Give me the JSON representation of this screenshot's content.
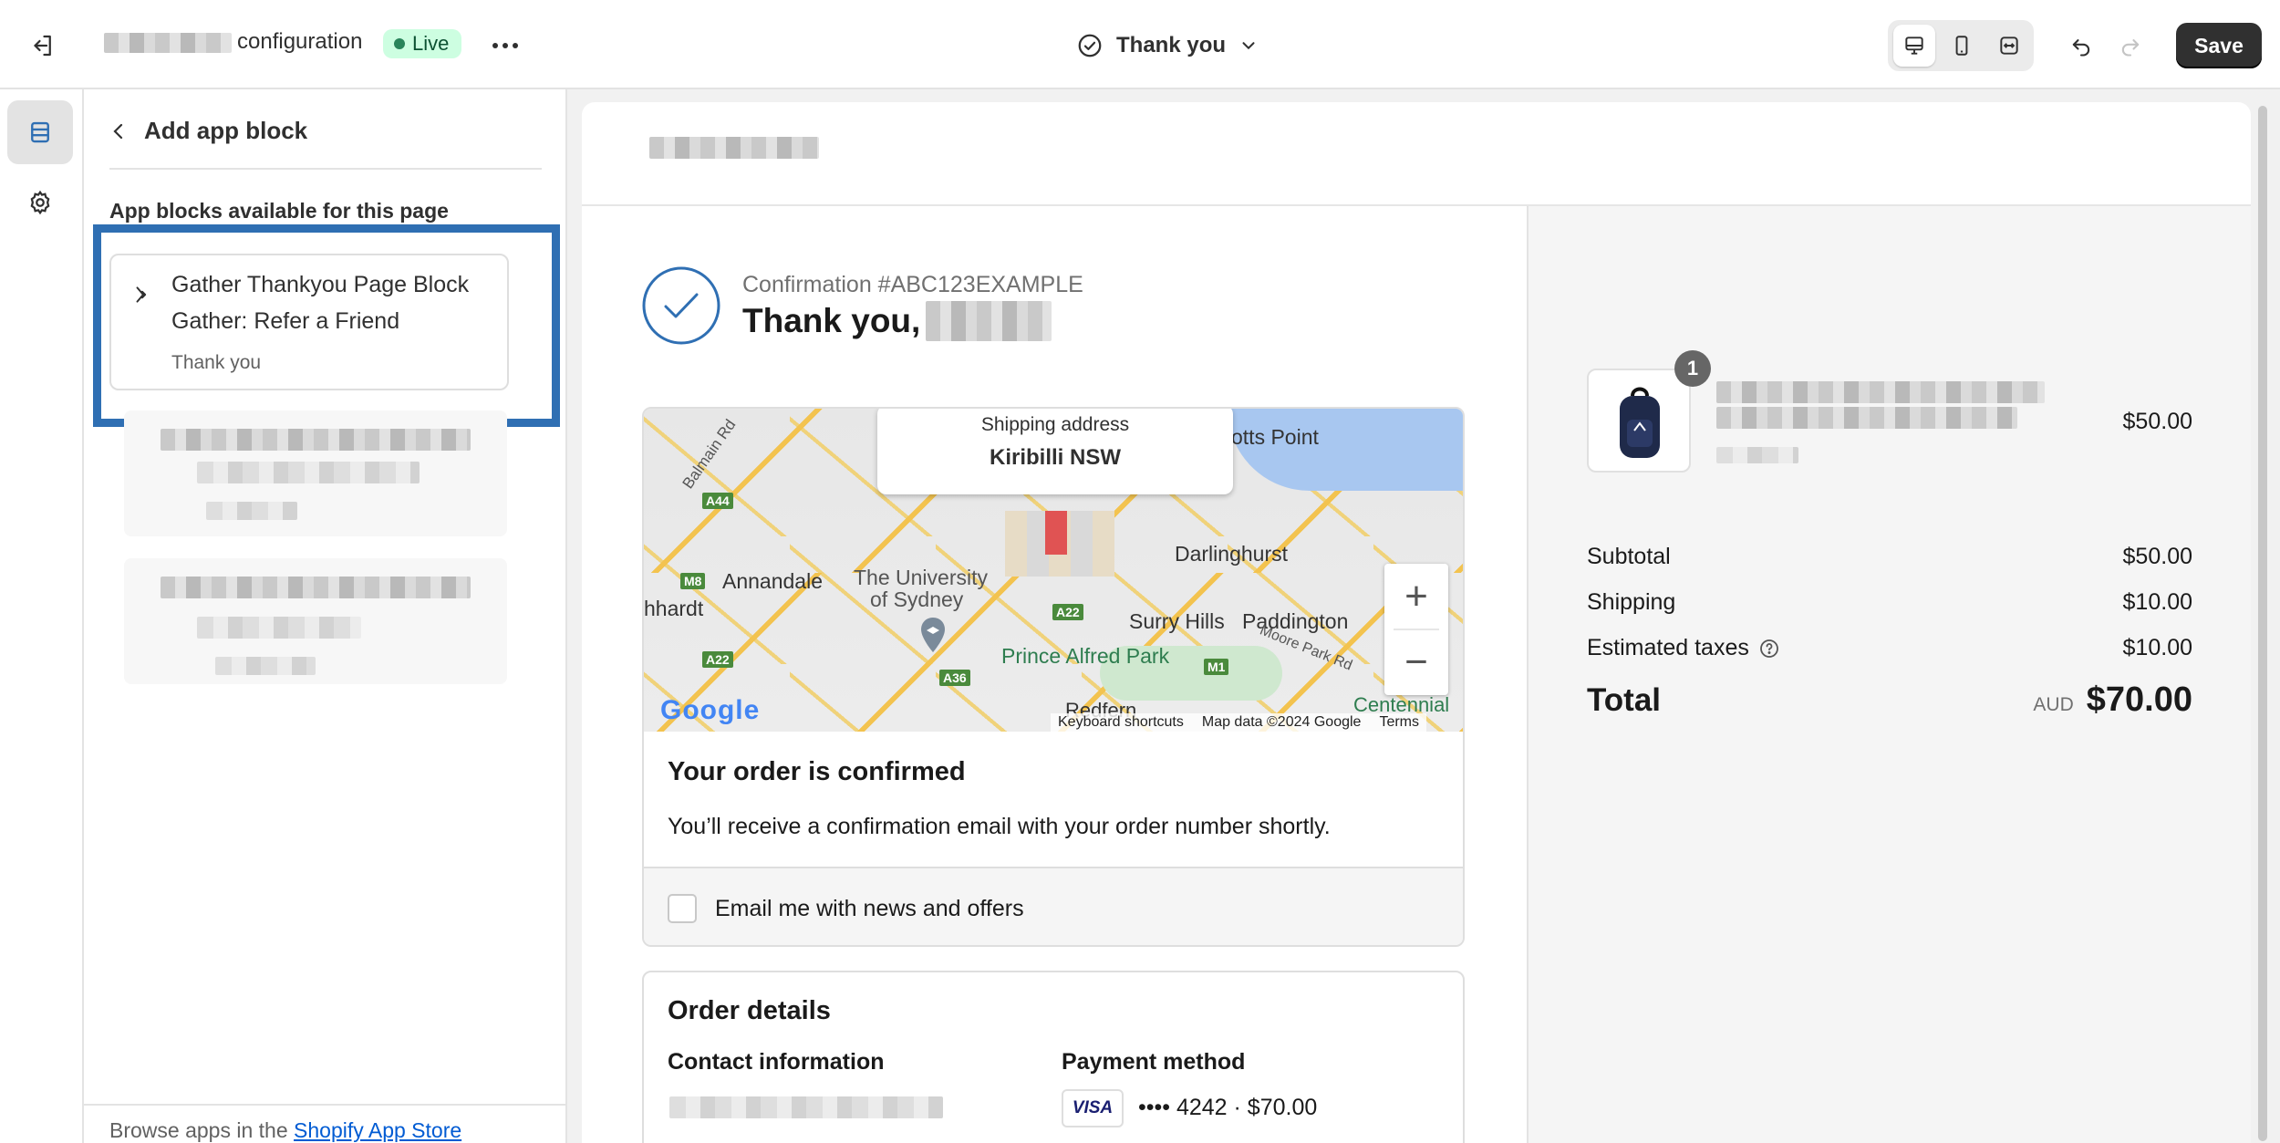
{
  "topbar": {
    "exit_icon": "exit-icon",
    "store_config_label": "configuration",
    "live_badge": "Live",
    "more_icon": "more-horizontal-icon",
    "page_selector_label": "Thank you",
    "save_label": "Save"
  },
  "panel": {
    "title": "Add app block",
    "section_heading": "App blocks available for this page",
    "app_block": {
      "title": "Gather Thankyou Page Block",
      "subtitle": "Gather: Refer a Friend",
      "page": "Thank you"
    },
    "footer_text": "Browse apps in the ",
    "footer_link": "Shopify App Store"
  },
  "checkout": {
    "confirmation_number": "Confirmation #ABC123EXAMPLE",
    "thank_you": "Thank you,",
    "map": {
      "shipping_label": "Shipping address",
      "shipping_value": "Kiribilli NSW",
      "labels": {
        "potts_point": "otts Point",
        "annandale": "Annandale",
        "university": "The University",
        "of_sydney": "of Sydney",
        "darlinghurst": "Darlinghurst",
        "surry_hills": "Surry Hills",
        "paddington": "Paddington",
        "prince_alfred": "Prince Alfred Park",
        "moore_park": "Moore Park Rd",
        "centennial": "Centennial",
        "redfern": "Redfern",
        "leichhardt": "hhardt",
        "balmain": "Balmain Rd",
        "a44": "A44",
        "m8": "M8",
        "a22a": "A22",
        "a22b": "A22",
        "a36": "A36",
        "m1": "M1"
      },
      "google": "Google",
      "keyboard_shortcuts": "Keyboard shortcuts",
      "map_data": "Map data ©2024 Google",
      "terms": "Terms",
      "zoom_in": "+",
      "zoom_out": "−"
    },
    "order_confirmed_title": "Your order is confirmed",
    "order_confirmed_text": "You’ll receive a confirmation email with your order number shortly.",
    "newsletter_label": "Email me with news and offers",
    "order_details_title": "Order details",
    "contact_info_label": "Contact information",
    "payment_method_label": "Payment method",
    "card_brand": "VISA",
    "payment_value": "•••• 4242 · $70.00"
  },
  "summary": {
    "item_quantity": "1",
    "item_price": "$50.00",
    "subtotal_label": "Subtotal",
    "subtotal_value": "$50.00",
    "shipping_label": "Shipping",
    "shipping_value": "$10.00",
    "taxes_label": "Estimated taxes",
    "taxes_value": "$10.00",
    "total_label": "Total",
    "currency": "AUD",
    "total_value": "$70.00"
  },
  "colors": {
    "accent_blue": "#2f6fb3",
    "live_green": "#cdfee1",
    "save_bg": "#303030"
  }
}
